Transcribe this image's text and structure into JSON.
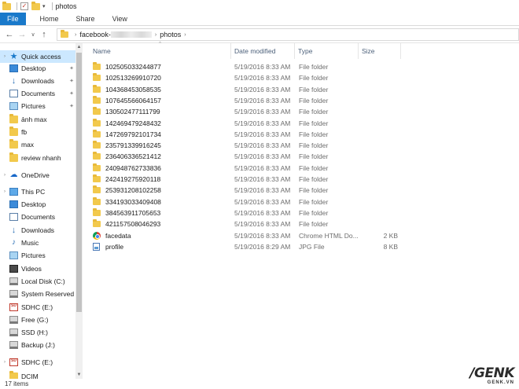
{
  "titlebar": {
    "title": "photos"
  },
  "ribbon": {
    "tabs": [
      "File",
      "Home",
      "Share",
      "View"
    ]
  },
  "address": {
    "crumbs": [
      "facebook-",
      "photos"
    ]
  },
  "navpane": {
    "items": [
      {
        "label": "Quick access",
        "icon": "star-icon",
        "sel": true
      },
      {
        "label": "Desktop",
        "icon": "desktop-icon",
        "pin": true
      },
      {
        "label": "Downloads",
        "icon": "download-icon",
        "pin": true
      },
      {
        "label": "Documents",
        "icon": "documents-icon",
        "pin": true
      },
      {
        "label": "Pictures",
        "icon": "pictures-icon",
        "pin": true
      },
      {
        "label": "ảnh max",
        "icon": "folder-icon"
      },
      {
        "label": "fb",
        "icon": "folder-icon"
      },
      {
        "label": "max",
        "icon": "folder-icon"
      },
      {
        "label": "review nhanh",
        "icon": "folder-icon"
      },
      {
        "label": "OneDrive",
        "icon": "onedrive-icon"
      },
      {
        "label": "This PC",
        "icon": "pc-icon"
      },
      {
        "label": "Desktop",
        "icon": "desktop-icon"
      },
      {
        "label": "Documents",
        "icon": "documents-icon"
      },
      {
        "label": "Downloads",
        "icon": "download-icon"
      },
      {
        "label": "Music",
        "icon": "music-icon"
      },
      {
        "label": "Pictures",
        "icon": "pictures-icon"
      },
      {
        "label": "Videos",
        "icon": "videos-icon"
      },
      {
        "label": "Local Disk (C:)",
        "icon": "disk-icon"
      },
      {
        "label": "System Reserved",
        "icon": "disk-icon"
      },
      {
        "label": "SDHC (E:)",
        "icon": "sd-card-icon"
      },
      {
        "label": "Free (G:)",
        "icon": "disk-icon"
      },
      {
        "label": "SSD (H:)",
        "icon": "disk-icon"
      },
      {
        "label": "Backup (J:)",
        "icon": "disk-icon"
      },
      {
        "label": "SDHC (E:)",
        "icon": "sd-card-icon"
      },
      {
        "label": "DCIM",
        "icon": "folder-icon"
      }
    ]
  },
  "columns": {
    "name": "Name",
    "date": "Date modified",
    "type": "Type",
    "size": "Size"
  },
  "files": [
    {
      "name": "102505033244877",
      "date": "5/19/2016 8:33 AM",
      "type": "File folder",
      "size": "",
      "kind": "folder"
    },
    {
      "name": "102513269910720",
      "date": "5/19/2016 8:33 AM",
      "type": "File folder",
      "size": "",
      "kind": "folder"
    },
    {
      "name": "104368453058535",
      "date": "5/19/2016 8:33 AM",
      "type": "File folder",
      "size": "",
      "kind": "folder"
    },
    {
      "name": "107645566064157",
      "date": "5/19/2016 8:33 AM",
      "type": "File folder",
      "size": "",
      "kind": "folder"
    },
    {
      "name": "130502477111799",
      "date": "5/19/2016 8:33 AM",
      "type": "File folder",
      "size": "",
      "kind": "folder"
    },
    {
      "name": "142469479248432",
      "date": "5/19/2016 8:33 AM",
      "type": "File folder",
      "size": "",
      "kind": "folder"
    },
    {
      "name": "147269792101734",
      "date": "5/19/2016 8:33 AM",
      "type": "File folder",
      "size": "",
      "kind": "folder"
    },
    {
      "name": "235791339916245",
      "date": "5/19/2016 8:33 AM",
      "type": "File folder",
      "size": "",
      "kind": "folder"
    },
    {
      "name": "236406336521412",
      "date": "5/19/2016 8:33 AM",
      "type": "File folder",
      "size": "",
      "kind": "folder"
    },
    {
      "name": "240948762733836",
      "date": "5/19/2016 8:33 AM",
      "type": "File folder",
      "size": "",
      "kind": "folder"
    },
    {
      "name": "242419275920118",
      "date": "5/19/2016 8:33 AM",
      "type": "File folder",
      "size": "",
      "kind": "folder"
    },
    {
      "name": "253931208102258",
      "date": "5/19/2016 8:33 AM",
      "type": "File folder",
      "size": "",
      "kind": "folder"
    },
    {
      "name": "334193033409408",
      "date": "5/19/2016 8:33 AM",
      "type": "File folder",
      "size": "",
      "kind": "folder"
    },
    {
      "name": "384563911705653",
      "date": "5/19/2016 8:33 AM",
      "type": "File folder",
      "size": "",
      "kind": "folder"
    },
    {
      "name": "421157508046293",
      "date": "5/19/2016 8:33 AM",
      "type": "File folder",
      "size": "",
      "kind": "folder"
    },
    {
      "name": "facedata",
      "date": "5/19/2016 8:33 AM",
      "type": "Chrome HTML Do...",
      "size": "2 KB",
      "kind": "chrome"
    },
    {
      "name": "profile",
      "date": "5/19/2016 8:29 AM",
      "type": "JPG File",
      "size": "8 KB",
      "kind": "jpg"
    }
  ],
  "status": {
    "count": "17 items"
  },
  "watermark": {
    "logo": "GENK",
    "site": "GENK.VN"
  }
}
